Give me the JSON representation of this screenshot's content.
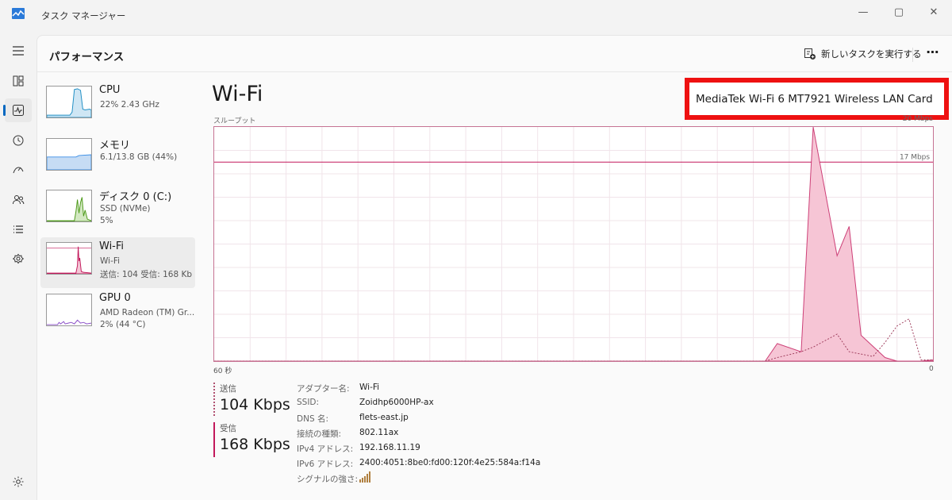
{
  "window": {
    "title": "タスク マネージャー",
    "controls": {
      "minimize": "—",
      "maximize": "▢",
      "close": "✕"
    }
  },
  "nav": {
    "items": [
      {
        "name": "menu",
        "icon": "hamburger-icon"
      },
      {
        "name": "processes",
        "icon": "processes-icon"
      },
      {
        "name": "performance",
        "icon": "performance-icon",
        "active": true
      },
      {
        "name": "app-history",
        "icon": "history-icon"
      },
      {
        "name": "startup",
        "icon": "startup-icon"
      },
      {
        "name": "users",
        "icon": "users-icon"
      },
      {
        "name": "details",
        "icon": "details-icon"
      },
      {
        "name": "services",
        "icon": "services-icon"
      },
      {
        "name": "settings",
        "icon": "gear-icon"
      }
    ]
  },
  "header": {
    "title": "パフォーマンス",
    "run_task_label": "新しいタスクを実行する",
    "more_label": "⋯"
  },
  "devices": [
    {
      "name": "CPU",
      "sub1": "22%  2.43 GHz",
      "sub2": "",
      "color": "#1e8ec4"
    },
    {
      "name": "メモリ",
      "sub1": "6.1/13.8 GB (44%)",
      "sub2": "",
      "color": "#3a8ee6"
    },
    {
      "name": "ディスク 0 (C:)",
      "sub1": "SSD (NVMe)",
      "sub2": "5%",
      "color": "#4d9a1a"
    },
    {
      "name": "Wi-Fi",
      "sub1": "Wi-Fi",
      "sub2": "送信: 104  受信: 168 Kb",
      "color": "#c2185b",
      "selected": true
    },
    {
      "name": "GPU 0",
      "sub1": "AMD Radeon (TM) Gr...",
      "sub2": "2%  (44 °C)",
      "color": "#8a4ec8"
    }
  ],
  "detail": {
    "title": "Wi-Fi",
    "adapter": "MediaTek Wi-Fi 6 MT7921 Wireless LAN Card",
    "throughput_label": "スループット",
    "max_label": "20 Mbps",
    "line_label": "17 Mbps",
    "axis_left": "60 秒",
    "axis_right": "0",
    "send": {
      "label": "送信",
      "value": "104 Kbps",
      "color": "#b05070"
    },
    "recv": {
      "label": "受信",
      "value": "168 Kbps",
      "color": "#c2185b"
    },
    "properties": [
      {
        "k": "アダプター名:",
        "v": "Wi-Fi"
      },
      {
        "k": "SSID:",
        "v": "Zoidhp6000HP-ax"
      },
      {
        "k": "DNS 名:",
        "v": "flets-east.jp"
      },
      {
        "k": "接続の種類:",
        "v": "802.11ax"
      },
      {
        "k": "IPv4 アドレス:",
        "v": "192.168.11.19"
      },
      {
        "k": "IPv6 アドレス:",
        "v": "2400:4051:8be0:fd00:120f:4e25:584a:f14a"
      },
      {
        "k": "シグナルの強さ:",
        "v": "",
        "icon": "signal-bars-icon"
      }
    ]
  },
  "chart_data": {
    "type": "area",
    "ylim": [
      0,
      20
    ],
    "xlim": [
      60,
      0
    ],
    "reference_line": 17,
    "series": [
      {
        "name": "受信",
        "x": [
          60,
          14,
          13,
          11,
          10,
          8,
          7,
          6,
          4,
          3,
          2,
          1,
          0
        ],
        "values": [
          0,
          0,
          1.5,
          0.8,
          20,
          9,
          11.5,
          2.2,
          0.3,
          0,
          0,
          0,
          0.1
        ]
      },
      {
        "name": "送信",
        "x": [
          60,
          14,
          13,
          11,
          10,
          8,
          7,
          6,
          5,
          4,
          3,
          2,
          1,
          0
        ],
        "values": [
          0,
          0,
          0.3,
          0.8,
          1.2,
          2.3,
          0.8,
          0.6,
          0.4,
          1.6,
          3,
          3.6,
          0.1,
          0.1
        ]
      }
    ]
  }
}
